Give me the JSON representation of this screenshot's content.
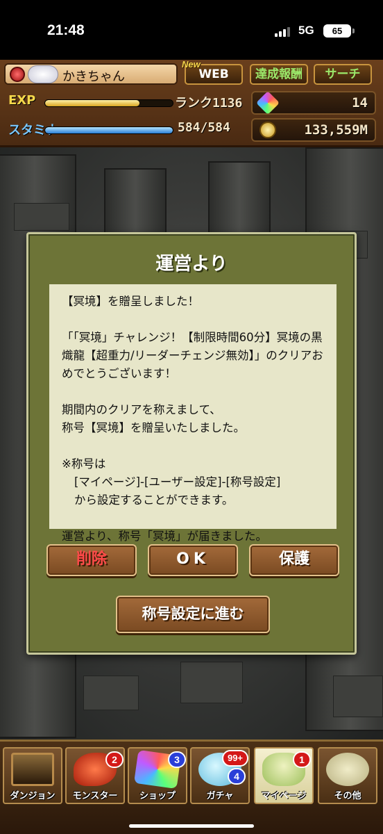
{
  "status_bar": {
    "time": "21:48",
    "network": "5G",
    "battery": "65"
  },
  "header": {
    "player_name": "かきちゃん",
    "new_tag": "New",
    "web_label": "WEB",
    "achievement_label": "達成報酬",
    "search_label": "サーチ",
    "exp_label": "EXP",
    "exp_progress": 0.74,
    "rank_text": "ランク1136",
    "stamina_label": "スタミナ",
    "stamina_text": "584/584",
    "stamina_progress": 1.0,
    "magic_stones": "14",
    "coins": "133,559M"
  },
  "dialog": {
    "title": "運営より",
    "message": {
      "line1": "【冥境】を贈呈しました！",
      "para2": "「「冥境」チャレンジ！【制限時間60分】冥境の黒熾龍【超重力/リーダーチェンジ無効】」のクリアおめでとうございます！",
      "para3_line1": "期間内のクリアを称えまして、",
      "para3_line2": "称号【冥境】を贈呈いたしました。",
      "note_line1": "※称号は",
      "note_line2": "[マイページ]-[ユーザー設定]-[称号設定]",
      "note_line3": "から設定することができます。",
      "final": "運営より、称号「冥境」が届きました。"
    },
    "delete_label": "削除",
    "ok_label": "OK",
    "protect_label": "保護",
    "title_settings_label": "称号設定に進む"
  },
  "bottom_nav": {
    "items": [
      {
        "label": "ダンジョン"
      },
      {
        "label": "モンスター",
        "badge": "2"
      },
      {
        "label": "ショップ",
        "badge": "3"
      },
      {
        "label": "ガチャ",
        "badge": "99+",
        "badge2": "4"
      },
      {
        "label": "マイページ",
        "badge": "1"
      },
      {
        "label": "その他"
      }
    ]
  },
  "colors": {
    "dialog_bg": "#6d7437",
    "message_bg": "#e7e6c9",
    "button_brown": "#8f5a2e",
    "delete_red": "#ff4a4a"
  }
}
